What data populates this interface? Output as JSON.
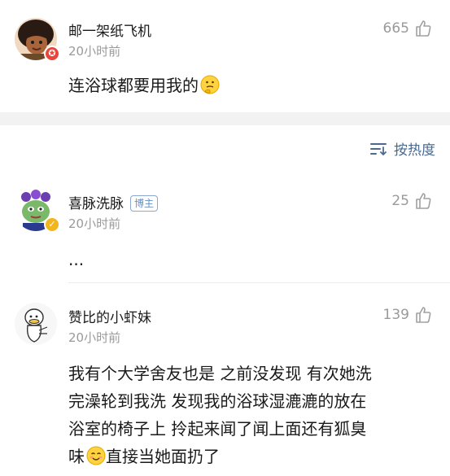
{
  "comments": [
    {
      "username": "邮一架纸飞机",
      "time": "20小时前",
      "likes": "665",
      "text": "连浴球都要用我的",
      "emoji": "thinking-face"
    },
    {
      "username": "喜脉洗脉",
      "tag": "博主",
      "time": "20小时前",
      "likes": "25",
      "text": "..."
    },
    {
      "username": "赞比的小虾妹",
      "time": "20小时前",
      "likes": "139",
      "text_line1": "我有个大学舍友也是 之前没发现 有次她洗",
      "text_line2": "完澡轮到我洗 发现我的浴球湿漉漉的放在",
      "text_line3": "浴室的椅子上 拎起来闻了闻上面还有狐臭",
      "text_line4_before": "味",
      "text_line4_after": "直接当她面扔了",
      "emoji": "smiling-face"
    }
  ],
  "sort": {
    "label": "按热度"
  },
  "colors": {
    "accent": "#4a6a8f",
    "muted": "#9a9a9a",
    "badge_red": "#e8453c",
    "badge_yellow": "#f2b51c"
  }
}
